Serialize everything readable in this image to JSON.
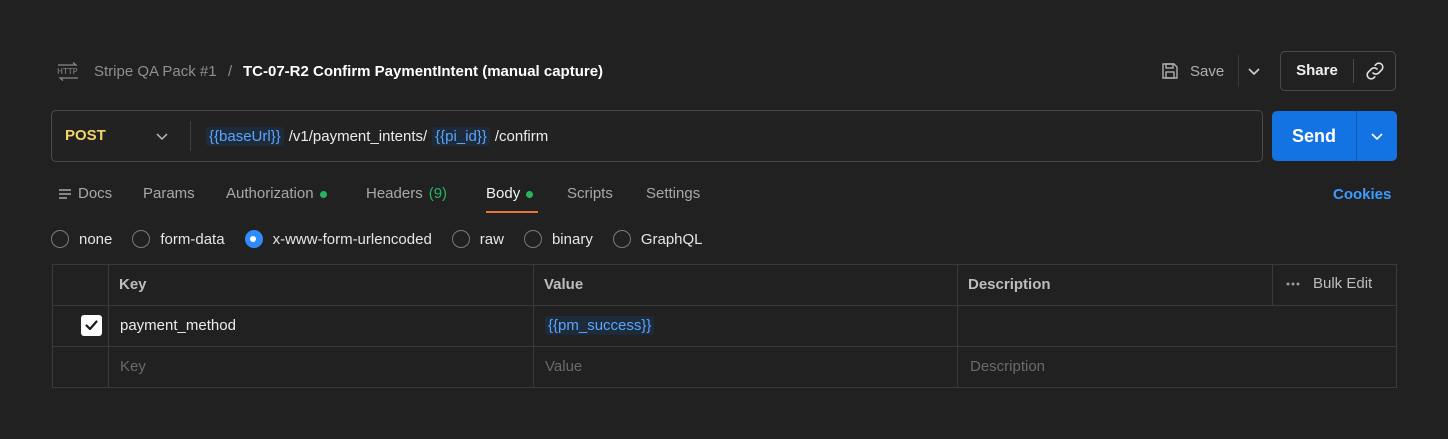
{
  "header": {
    "protocol_icon": "http-icon",
    "collection": "Stripe QA Pack #1",
    "separator": "/",
    "request_name": "TC-07-R2 Confirm PaymentIntent (manual capture)",
    "save_label": "Save",
    "share_label": "Share"
  },
  "request": {
    "method": "POST",
    "url_parts": [
      {
        "text": "{{baseUrl}}",
        "variable": true
      },
      {
        "text": "/v1/payment_intents/",
        "variable": false
      },
      {
        "text": "{{pi_id}}",
        "variable": true
      },
      {
        "text": "/confirm",
        "variable": false
      }
    ],
    "send_label": "Send"
  },
  "tabs": {
    "docs": "Docs",
    "params": "Params",
    "authorization": "Authorization",
    "headers": "Headers",
    "headers_count": "(9)",
    "body": "Body",
    "scripts": "Scripts",
    "settings": "Settings",
    "active": "Body",
    "cookies": "Cookies"
  },
  "body_types": {
    "options": [
      "none",
      "form-data",
      "x-www-form-urlencoded",
      "raw",
      "binary",
      "GraphQL"
    ],
    "selected": "x-www-form-urlencoded"
  },
  "table": {
    "headers": {
      "key": "Key",
      "value": "Value",
      "description": "Description",
      "bulk_edit": "Bulk Edit"
    },
    "rows": [
      {
        "checked": true,
        "key": "payment_method",
        "value": "{{pm_success}}",
        "description": ""
      }
    ],
    "placeholders": {
      "key": "Key",
      "value": "Value",
      "description": "Description"
    }
  },
  "colors": {
    "background": "#212121",
    "method_post": "#f3d46a",
    "variable": "#5aa6ff",
    "send": "#1373e2",
    "active_tab_underline": "#e8743a",
    "status_dot": "#29b360",
    "link": "#3e9bff"
  }
}
